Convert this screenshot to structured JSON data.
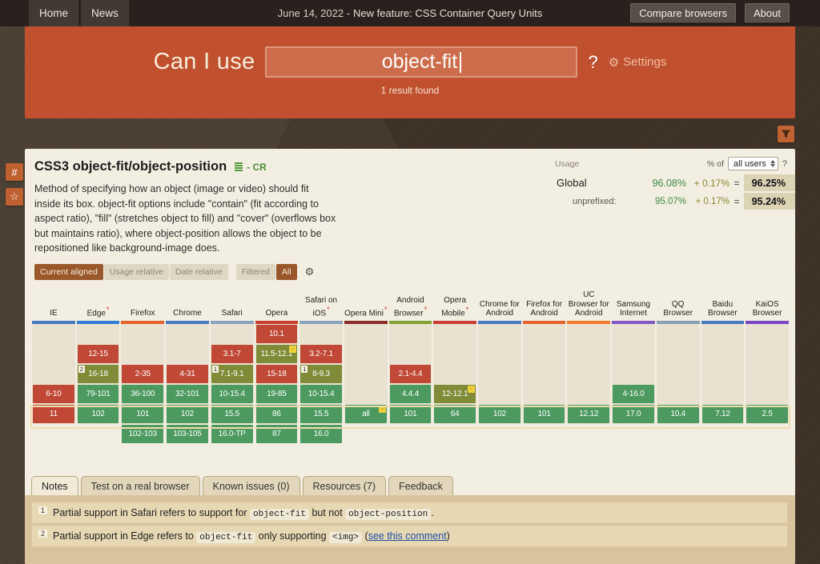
{
  "topbar": {
    "home": "Home",
    "news": "News",
    "date_text": "June 14, 2022 - ",
    "feature_link": "New feature: CSS Container Query Units",
    "compare": "Compare browsers",
    "about": "About"
  },
  "header": {
    "brand": "Can I use",
    "search_value": "object-fit",
    "question_mark": "?",
    "settings": "Settings",
    "result_count": "1 result found"
  },
  "sidebar": {
    "hash": "#",
    "star": "☆"
  },
  "feature": {
    "title": "CSS3 object-fit/object-position",
    "status": "- CR",
    "description": "Method of specifying how an object (image or video) should fit inside its box. object-fit options include \"contain\" (fit according to aspect ratio), \"fill\" (stretches object to fill) and \"cover\" (overflows box but maintains ratio), where object-position allows the object to be repositioned like background-image does."
  },
  "usage": {
    "label": "Usage",
    "percent_of": "% of",
    "select_value": "all users",
    "help": "?",
    "rows": [
      {
        "label": "Global",
        "base": "96.08%",
        "plus": "+ 0.17%",
        "eq": "=",
        "total": "96.25%"
      },
      {
        "label": "unprefixed:",
        "base": "95.07%",
        "plus": "+ 0.17%",
        "eq": "=",
        "total": "95.24%"
      }
    ]
  },
  "controls": [
    {
      "label": "Current aligned",
      "active": true
    },
    {
      "label": "Usage relative",
      "active": false
    },
    {
      "label": "Date relative",
      "active": false
    },
    {
      "label": "Filtered",
      "active": false
    },
    {
      "label": "All",
      "active": true
    }
  ],
  "table": {
    "cell_colors": {
      "y": "#4c9a5f",
      "n": "#c14836",
      "a": "#7f8b37"
    },
    "current_row_index": 4,
    "browsers": [
      {
        "name": "IE",
        "color": "#4579c4",
        "asterisk": false
      },
      {
        "name": "Edge",
        "color": "#2f7cd6",
        "asterisk": true
      },
      {
        "name": "Firefox",
        "color": "#e6632e",
        "asterisk": false
      },
      {
        "name": "Chrome",
        "color": "#4579c4",
        "asterisk": false
      },
      {
        "name": "Safari",
        "color": "#8aa3bd",
        "asterisk": false
      },
      {
        "name": "Opera",
        "color": "#cc3d33",
        "asterisk": false
      },
      {
        "name": "Safari on iOS",
        "color": "#8aa3bd",
        "asterisk": true
      },
      {
        "name": "Opera Mini",
        "color": "#8a2f28",
        "asterisk": true
      },
      {
        "name": "Android Browser",
        "color": "#84a135",
        "asterisk": true
      },
      {
        "name": "Opera Mobile",
        "color": "#cc3d33",
        "asterisk": true
      },
      {
        "name": "Chrome for Android",
        "color": "#4579c4",
        "asterisk": false
      },
      {
        "name": "Firefox for Android",
        "color": "#e6632e",
        "asterisk": false
      },
      {
        "name": "UC Browser for Android",
        "color": "#f07c2a",
        "asterisk": false
      },
      {
        "name": "Samsung Internet",
        "color": "#8258c8",
        "asterisk": false
      },
      {
        "name": "QQ Browser",
        "color": "#8aa0b4",
        "asterisk": false
      },
      {
        "name": "Baidu Browser",
        "color": "#4579c4",
        "asterisk": false
      },
      {
        "name": "KaiOS Browser",
        "color": "#7b46c4",
        "asterisk": false
      }
    ],
    "rows": [
      [
        null,
        null,
        null,
        null,
        null,
        {
          "v": "10.1",
          "t": "n"
        },
        null,
        null,
        null,
        null,
        null,
        null,
        null,
        null,
        null,
        null,
        null
      ],
      [
        null,
        {
          "v": "12-15",
          "t": "n"
        },
        null,
        null,
        {
          "v": "3.1-7",
          "t": "n"
        },
        {
          "v": "11.5-12.1",
          "t": "a",
          "note": true
        },
        {
          "v": "3.2-7.1",
          "t": "n"
        },
        null,
        null,
        null,
        null,
        null,
        null,
        null,
        null,
        null,
        null
      ],
      [
        null,
        {
          "v": "16-18",
          "t": "a",
          "sup": "2"
        },
        {
          "v": "2-35",
          "t": "n"
        },
        {
          "v": "4-31",
          "t": "n"
        },
        {
          "v": "7.1-9.1",
          "t": "a",
          "sup": "1"
        },
        {
          "v": "15-18",
          "t": "n"
        },
        {
          "v": "8-9.3",
          "t": "a",
          "sup": "1"
        },
        null,
        {
          "v": "2.1-4.4",
          "t": "n"
        },
        null,
        null,
        null,
        null,
        null,
        null,
        null,
        null
      ],
      [
        {
          "v": "6-10",
          "t": "n"
        },
        {
          "v": "79-101",
          "t": "y"
        },
        {
          "v": "36-100",
          "t": "y"
        },
        {
          "v": "32-101",
          "t": "y"
        },
        {
          "v": "10-15.4",
          "t": "y"
        },
        {
          "v": "19-85",
          "t": "y"
        },
        {
          "v": "10-15.4",
          "t": "y"
        },
        null,
        {
          "v": "4.4.4",
          "t": "y"
        },
        {
          "v": "12-12.1",
          "t": "a",
          "note": true
        },
        null,
        null,
        null,
        {
          "v": "4-16.0",
          "t": "y"
        },
        null,
        null,
        null
      ],
      [
        {
          "v": "11",
          "t": "n"
        },
        {
          "v": "102",
          "t": "y"
        },
        {
          "v": "101",
          "t": "y"
        },
        {
          "v": "102",
          "t": "y"
        },
        {
          "v": "15.5",
          "t": "y"
        },
        {
          "v": "86",
          "t": "y"
        },
        {
          "v": "15.5",
          "t": "y"
        },
        {
          "v": "all",
          "t": "y",
          "note": true
        },
        {
          "v": "101",
          "t": "y"
        },
        {
          "v": "64",
          "t": "y"
        },
        {
          "v": "102",
          "t": "y"
        },
        {
          "v": "101",
          "t": "y"
        },
        {
          "v": "12.12",
          "t": "y"
        },
        {
          "v": "17.0",
          "t": "y"
        },
        {
          "v": "10.4",
          "t": "y"
        },
        {
          "v": "7.12",
          "t": "y"
        },
        {
          "v": "2.5",
          "t": "y"
        }
      ],
      [
        null,
        null,
        {
          "v": "102-103",
          "t": "y"
        },
        {
          "v": "103-105",
          "t": "y"
        },
        {
          "v": "16.0-TP",
          "t": "y"
        },
        {
          "v": "87",
          "t": "y"
        },
        {
          "v": "16.0",
          "t": "y"
        },
        null,
        null,
        null,
        null,
        null,
        null,
        null,
        null,
        null,
        null
      ]
    ]
  },
  "tabs": [
    {
      "label": "Notes",
      "active": true
    },
    {
      "label": "Test on a real browser",
      "active": false
    },
    {
      "label": "Known issues (0)",
      "active": false
    },
    {
      "label": "Resources (7)",
      "active": false
    },
    {
      "label": "Feedback",
      "active": false
    }
  ],
  "notes": [
    {
      "sup": "1",
      "segments": [
        {
          "t": "text",
          "v": "Partial support in Safari refers to support for "
        },
        {
          "t": "code",
          "v": "object-fit"
        },
        {
          "t": "text",
          "v": " but not "
        },
        {
          "t": "code",
          "v": "object-position"
        },
        {
          "t": "text",
          "v": "."
        }
      ]
    },
    {
      "sup": "2",
      "segments": [
        {
          "t": "text",
          "v": "Partial support in Edge refers to "
        },
        {
          "t": "code",
          "v": "object-fit"
        },
        {
          "t": "text",
          "v": " only supporting "
        },
        {
          "t": "code",
          "v": "<img>"
        },
        {
          "t": "text",
          "v": " ("
        },
        {
          "t": "link",
          "v": "see this comment"
        },
        {
          "t": "text",
          "v": ")"
        }
      ]
    }
  ]
}
